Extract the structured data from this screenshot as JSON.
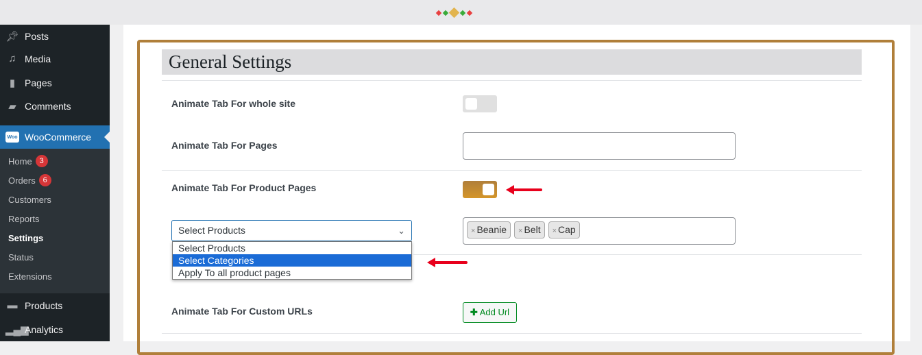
{
  "colors": {
    "accent": "#b07f3a",
    "wp_blue": "#2271b1",
    "badge": "#d63638",
    "arrow": "#e8001c"
  },
  "sidebar": {
    "items": [
      {
        "label": "Posts",
        "icon": "pin-icon"
      },
      {
        "label": "Media",
        "icon": "media-icon"
      },
      {
        "label": "Pages",
        "icon": "pages-icon"
      },
      {
        "label": "Comments",
        "icon": "comment-icon"
      }
    ],
    "woocommerce": {
      "label": "WooCommerce",
      "icon_text": "Woo"
    },
    "submenu": [
      {
        "label": "Home",
        "badge": "3"
      },
      {
        "label": "Orders",
        "badge": "6"
      },
      {
        "label": "Customers"
      },
      {
        "label": "Reports"
      },
      {
        "label": "Settings",
        "current": true
      },
      {
        "label": "Status"
      },
      {
        "label": "Extensions"
      }
    ],
    "bottom": [
      {
        "label": "Products",
        "icon": "archive-icon"
      },
      {
        "label": "Analytics",
        "icon": "bar-chart-icon"
      }
    ]
  },
  "main": {
    "title": "General Settings",
    "rows": {
      "whole_site": {
        "label": "Animate Tab For whole site",
        "enabled": false
      },
      "pages": {
        "label": "Animate Tab For Pages",
        "value": ""
      },
      "product_pages": {
        "label": "Animate Tab For Product Pages",
        "enabled": true
      },
      "custom_urls": {
        "label": "Animate Tab For Custom URLs",
        "button": "Add Url"
      }
    },
    "select": {
      "value": "Select Products",
      "options": [
        "Select Products",
        "Select Categories",
        "Apply To all product pages"
      ],
      "highlighted": 1
    },
    "tags": [
      "Beanie",
      "Belt",
      "Cap"
    ]
  }
}
